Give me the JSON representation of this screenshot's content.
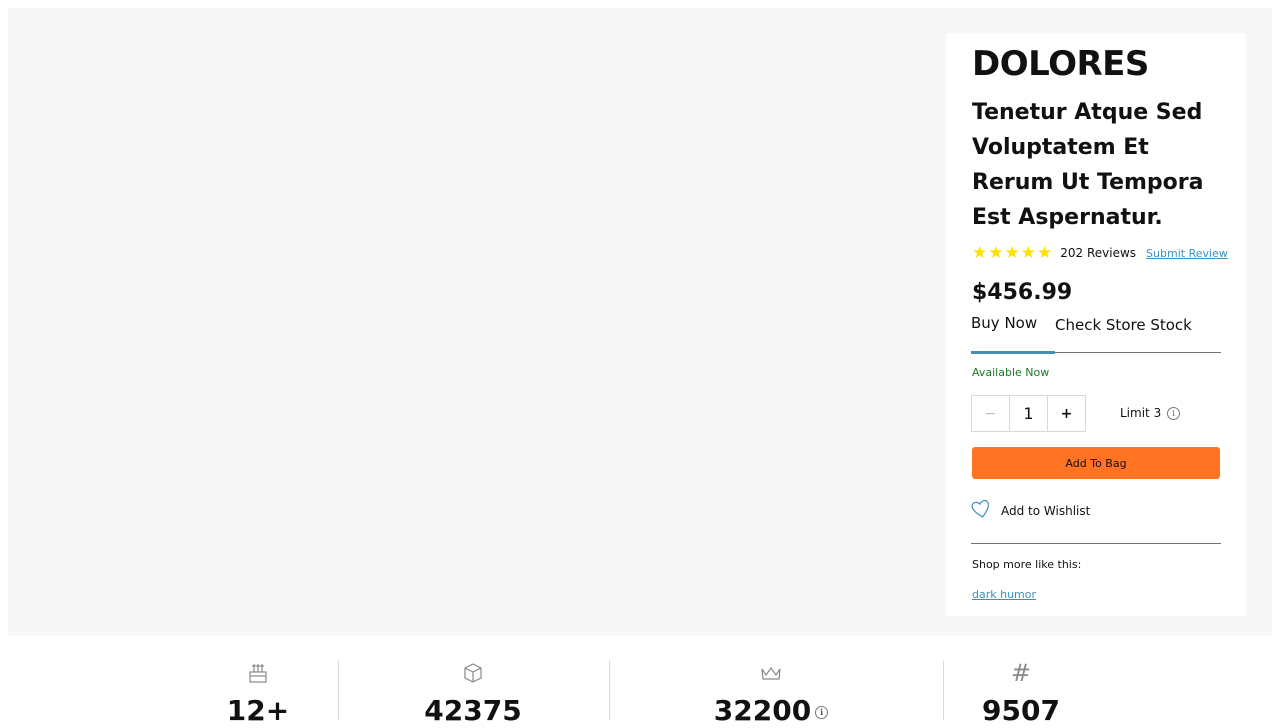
{
  "product": {
    "brand": "DOLORES",
    "title": "Tenetur Atque Sed Voluptatem Et Rerum Ut Tempora Est Aspernatur.",
    "rating": 5,
    "reviews": "202 Reviews",
    "submit_review": "Submit Review",
    "price": "$456.99",
    "tabs": [
      "Buy Now",
      "Check Store Stock"
    ],
    "availability": "Available Now",
    "quantity": "1",
    "limit": "Limit 3",
    "add_to_bag": "Add To Bag",
    "wishlist": "Add to Wishlist",
    "shop_more": "Shop more like this:",
    "tag": "dark humor"
  },
  "stats": [
    {
      "icon": "cake-icon",
      "value": "12+"
    },
    {
      "icon": "box-icon",
      "value": "42375"
    },
    {
      "icon": "crown-icon",
      "value": "32200"
    },
    {
      "icon": "hash-icon",
      "value": "9507"
    }
  ],
  "colors": {
    "accent": "#ff7322",
    "link": "#3d8fbf",
    "available": "#1d7a25",
    "star": "#ffe100",
    "tab_active": "#4b8fb0"
  }
}
